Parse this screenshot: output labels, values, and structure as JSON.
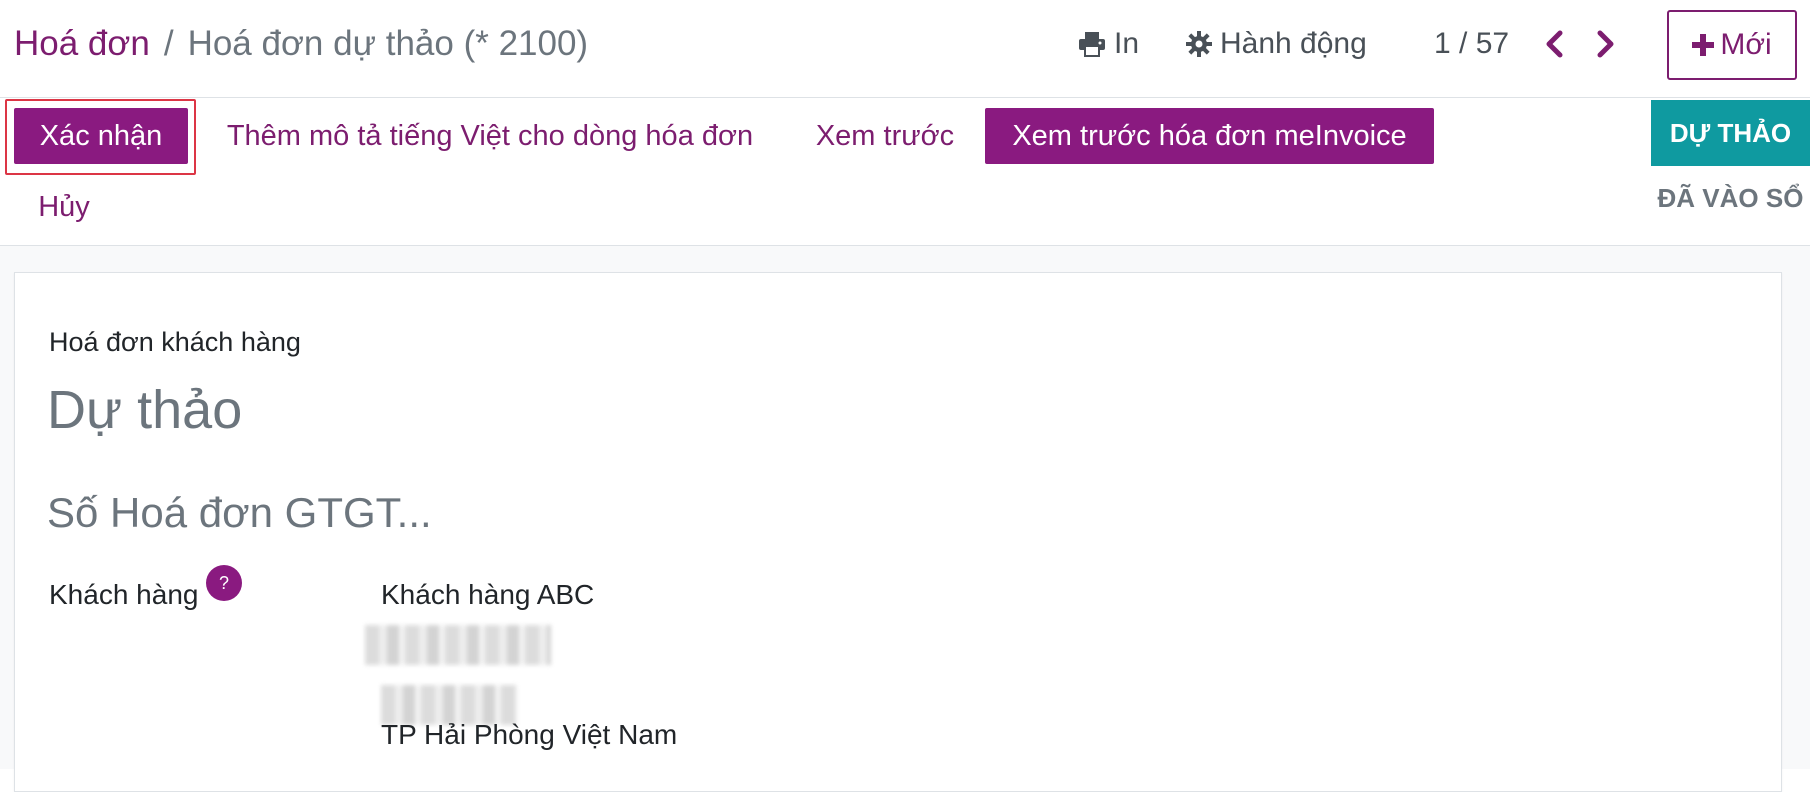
{
  "breadcrumb": {
    "parent": "Hoá đơn",
    "separator": "/",
    "current": "Hoá đơn dự thảo (* 2100)"
  },
  "toolbar": {
    "print_label": "In",
    "print_icon": "printer-icon",
    "action_label": "Hành động",
    "action_icon": "gear-icon",
    "pager": "1 / 57",
    "prev_icon": "chevron-left-icon",
    "next_icon": "chevron-right-icon",
    "new_label": "Mới",
    "new_icon": "plus-icon"
  },
  "statusbar": {
    "confirm_label": "Xác nhận",
    "add_description_label": "Thêm mô tả tiếng Việt cho dòng hóa đơn",
    "preview_label": "Xem trước",
    "preview_meinvoice_label": "Xem trước hóa đơn meInvoice",
    "cancel_label": "Hủy",
    "states": [
      {
        "label": "DỰ THẢO",
        "active": true
      },
      {
        "label": "ĐÃ VÀO SỔ",
        "active": false
      }
    ]
  },
  "form": {
    "invoice_type": "Hoá đơn khách hàng",
    "state_title": "Dự thảo",
    "vat_number_placeholder": "Số Hoá đơn GTGT...",
    "customer_label": "Khách hàng",
    "help_icon_text": "?",
    "customer": {
      "name": "Khách hàng ABC",
      "city_country": "TP Hải Phòng Việt Nam"
    }
  },
  "colors": {
    "brand": "#8a1a80",
    "brand_text": "#7c1d6f",
    "state_active": "#0f9aa0",
    "highlight_border": "#dc3545"
  }
}
